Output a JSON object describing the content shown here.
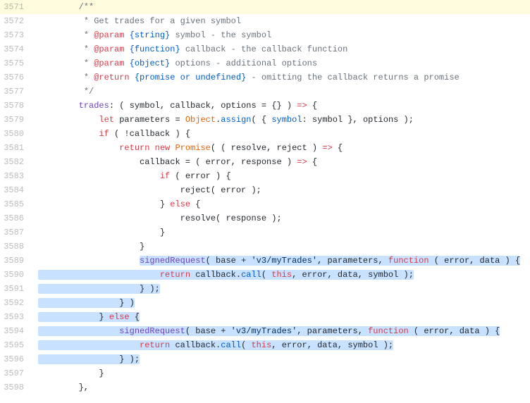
{
  "lines": [
    {
      "num": "3571",
      "hl": true,
      "indent": "        ",
      "sel": null,
      "tokens": [
        {
          "c": "tk-c",
          "t": "/**"
        }
      ]
    },
    {
      "num": "3572",
      "hl": false,
      "indent": "         ",
      "sel": null,
      "tokens": [
        {
          "c": "tk-c",
          "t": "* Get trades for a given symbol"
        }
      ]
    },
    {
      "num": "3573",
      "hl": false,
      "indent": "         ",
      "sel": null,
      "tokens": [
        {
          "c": "tk-c",
          "t": "* "
        },
        {
          "c": "tk-ck",
          "t": "@param"
        },
        {
          "c": "tk-c",
          "t": " "
        },
        {
          "c": "tk-ct",
          "t": "{string}"
        },
        {
          "c": "tk-c",
          "t": " symbol - the symbol"
        }
      ]
    },
    {
      "num": "3574",
      "hl": false,
      "indent": "         ",
      "sel": null,
      "tokens": [
        {
          "c": "tk-c",
          "t": "* "
        },
        {
          "c": "tk-ck",
          "t": "@param"
        },
        {
          "c": "tk-c",
          "t": " "
        },
        {
          "c": "tk-ct",
          "t": "{function}"
        },
        {
          "c": "tk-c",
          "t": " callback - the callback function"
        }
      ]
    },
    {
      "num": "3575",
      "hl": false,
      "indent": "         ",
      "sel": null,
      "tokens": [
        {
          "c": "tk-c",
          "t": "* "
        },
        {
          "c": "tk-ck",
          "t": "@param"
        },
        {
          "c": "tk-c",
          "t": " "
        },
        {
          "c": "tk-ct",
          "t": "{object}"
        },
        {
          "c": "tk-c",
          "t": " options - additional options"
        }
      ]
    },
    {
      "num": "3576",
      "hl": false,
      "indent": "         ",
      "sel": null,
      "tokens": [
        {
          "c": "tk-c",
          "t": "* "
        },
        {
          "c": "tk-ck",
          "t": "@return"
        },
        {
          "c": "tk-c",
          "t": " "
        },
        {
          "c": "tk-ct",
          "t": "{promise or undefined}"
        },
        {
          "c": "tk-c",
          "t": " - omitting the callback returns a promise"
        }
      ]
    },
    {
      "num": "3577",
      "hl": false,
      "indent": "         ",
      "sel": null,
      "tokens": [
        {
          "c": "tk-c",
          "t": "*/"
        }
      ]
    },
    {
      "num": "3578",
      "hl": false,
      "indent": "        ",
      "sel": null,
      "tokens": [
        {
          "c": "tk-fn",
          "t": "trades"
        },
        {
          "c": "tk-p",
          "t": ": ( symbol, callback, options = {} ) "
        },
        {
          "c": "tk-k",
          "t": "=>"
        },
        {
          "c": "tk-p",
          "t": " {"
        }
      ]
    },
    {
      "num": "3579",
      "hl": false,
      "indent": "            ",
      "sel": null,
      "tokens": [
        {
          "c": "tk-k",
          "t": "let"
        },
        {
          "c": "tk-p",
          "t": " parameters = "
        },
        {
          "c": "tk-nm",
          "t": "Object"
        },
        {
          "c": "tk-p",
          "t": "."
        },
        {
          "c": "tk-b",
          "t": "assign"
        },
        {
          "c": "tk-p",
          "t": "( { "
        },
        {
          "c": "tk-pr",
          "t": "symbol"
        },
        {
          "c": "tk-p",
          "t": ": symbol }, options );"
        }
      ]
    },
    {
      "num": "3580",
      "hl": false,
      "indent": "            ",
      "sel": null,
      "tokens": [
        {
          "c": "tk-k",
          "t": "if"
        },
        {
          "c": "tk-p",
          "t": " ( !callback ) {"
        }
      ]
    },
    {
      "num": "3581",
      "hl": false,
      "indent": "                ",
      "sel": null,
      "tokens": [
        {
          "c": "tk-k",
          "t": "return"
        },
        {
          "c": "tk-p",
          "t": " "
        },
        {
          "c": "tk-k",
          "t": "new"
        },
        {
          "c": "tk-p",
          "t": " "
        },
        {
          "c": "tk-nm",
          "t": "Promise"
        },
        {
          "c": "tk-p",
          "t": "( ( resolve, reject ) "
        },
        {
          "c": "tk-k",
          "t": "=>"
        },
        {
          "c": "tk-p",
          "t": " {"
        }
      ]
    },
    {
      "num": "3582",
      "hl": false,
      "indent": "                    ",
      "sel": null,
      "tokens": [
        {
          "c": "tk-p",
          "t": "callback = ( error, response ) "
        },
        {
          "c": "tk-k",
          "t": "=>"
        },
        {
          "c": "tk-p",
          "t": " {"
        }
      ]
    },
    {
      "num": "3583",
      "hl": false,
      "indent": "                        ",
      "sel": null,
      "tokens": [
        {
          "c": "tk-k",
          "t": "if"
        },
        {
          "c": "tk-p",
          "t": " ( error ) {"
        }
      ]
    },
    {
      "num": "3584",
      "hl": false,
      "indent": "                            ",
      "sel": null,
      "tokens": [
        {
          "c": "tk-p",
          "t": "reject( error );"
        }
      ]
    },
    {
      "num": "3585",
      "hl": false,
      "indent": "                        ",
      "sel": null,
      "tokens": [
        {
          "c": "tk-p",
          "t": "} "
        },
        {
          "c": "tk-k",
          "t": "else"
        },
        {
          "c": "tk-p",
          "t": " {"
        }
      ]
    },
    {
      "num": "3586",
      "hl": false,
      "indent": "                            ",
      "sel": null,
      "tokens": [
        {
          "c": "tk-p",
          "t": "resolve( response );"
        }
      ]
    },
    {
      "num": "3587",
      "hl": false,
      "indent": "                        ",
      "sel": null,
      "tokens": [
        {
          "c": "tk-p",
          "t": "}"
        }
      ]
    },
    {
      "num": "3588",
      "hl": false,
      "indent": "                    ",
      "sel": null,
      "tokens": [
        {
          "c": "tk-p",
          "t": "}"
        }
      ]
    },
    {
      "num": "3589",
      "hl": false,
      "indent": "                    ",
      "sel": "rest",
      "tokens": [
        {
          "c": "tk-fn",
          "t": "signedRequest"
        },
        {
          "c": "tk-p",
          "t": "( base + "
        },
        {
          "c": "tk-s",
          "t": "'v3/myTrades'"
        },
        {
          "c": "tk-p",
          "t": ", parameters, "
        },
        {
          "c": "tk-k",
          "t": "function"
        },
        {
          "c": "tk-p",
          "t": " ( error, data ) {"
        }
      ]
    },
    {
      "num": "3590",
      "hl": false,
      "indent": "",
      "sel": "full",
      "tokens": [
        {
          "c": "tk-p",
          "t": "                        "
        },
        {
          "c": "tk-k",
          "t": "return"
        },
        {
          "c": "tk-p",
          "t": " callback."
        },
        {
          "c": "tk-b",
          "t": "call"
        },
        {
          "c": "tk-p",
          "t": "( "
        },
        {
          "c": "tk-k",
          "t": "this"
        },
        {
          "c": "tk-p",
          "t": ", error, data, symbol );"
        }
      ]
    },
    {
      "num": "3591",
      "hl": false,
      "indent": "",
      "sel": "full",
      "tokens": [
        {
          "c": "tk-p",
          "t": "                    } );"
        }
      ]
    },
    {
      "num": "3592",
      "hl": false,
      "indent": "",
      "sel": "full",
      "tokens": [
        {
          "c": "tk-p",
          "t": "                } )"
        }
      ]
    },
    {
      "num": "3593",
      "hl": false,
      "indent": "",
      "sel": "full",
      "tokens": [
        {
          "c": "tk-p",
          "t": "            } "
        },
        {
          "c": "tk-k",
          "t": "else"
        },
        {
          "c": "tk-p",
          "t": " {"
        }
      ]
    },
    {
      "num": "3594",
      "hl": false,
      "indent": "",
      "sel": "full",
      "tokens": [
        {
          "c": "tk-p",
          "t": "                "
        },
        {
          "c": "tk-fn",
          "t": "signedRequest"
        },
        {
          "c": "tk-p",
          "t": "( base + "
        },
        {
          "c": "tk-s",
          "t": "'v3/myTrades'"
        },
        {
          "c": "tk-p",
          "t": ", parameters, "
        },
        {
          "c": "tk-k",
          "t": "function"
        },
        {
          "c": "tk-p",
          "t": " ( error, data ) {"
        }
      ]
    },
    {
      "num": "3595",
      "hl": false,
      "indent": "",
      "sel": "full",
      "tokens": [
        {
          "c": "tk-p",
          "t": "                    "
        },
        {
          "c": "tk-k",
          "t": "return"
        },
        {
          "c": "tk-p",
          "t": " callback."
        },
        {
          "c": "tk-b",
          "t": "call"
        },
        {
          "c": "tk-p",
          "t": "( "
        },
        {
          "c": "tk-k",
          "t": "this"
        },
        {
          "c": "tk-p",
          "t": ", error, data, symbol );"
        }
      ]
    },
    {
      "num": "3596",
      "hl": false,
      "indent": "",
      "sel": "full",
      "tokens": [
        {
          "c": "tk-p",
          "t": "                } );"
        }
      ]
    },
    {
      "num": "3597",
      "hl": false,
      "indent": "            ",
      "sel": null,
      "tokens": [
        {
          "c": "tk-p",
          "t": "}"
        }
      ]
    },
    {
      "num": "3598",
      "hl": false,
      "indent": "        ",
      "sel": null,
      "tokens": [
        {
          "c": "tk-p",
          "t": "},"
        }
      ]
    }
  ]
}
